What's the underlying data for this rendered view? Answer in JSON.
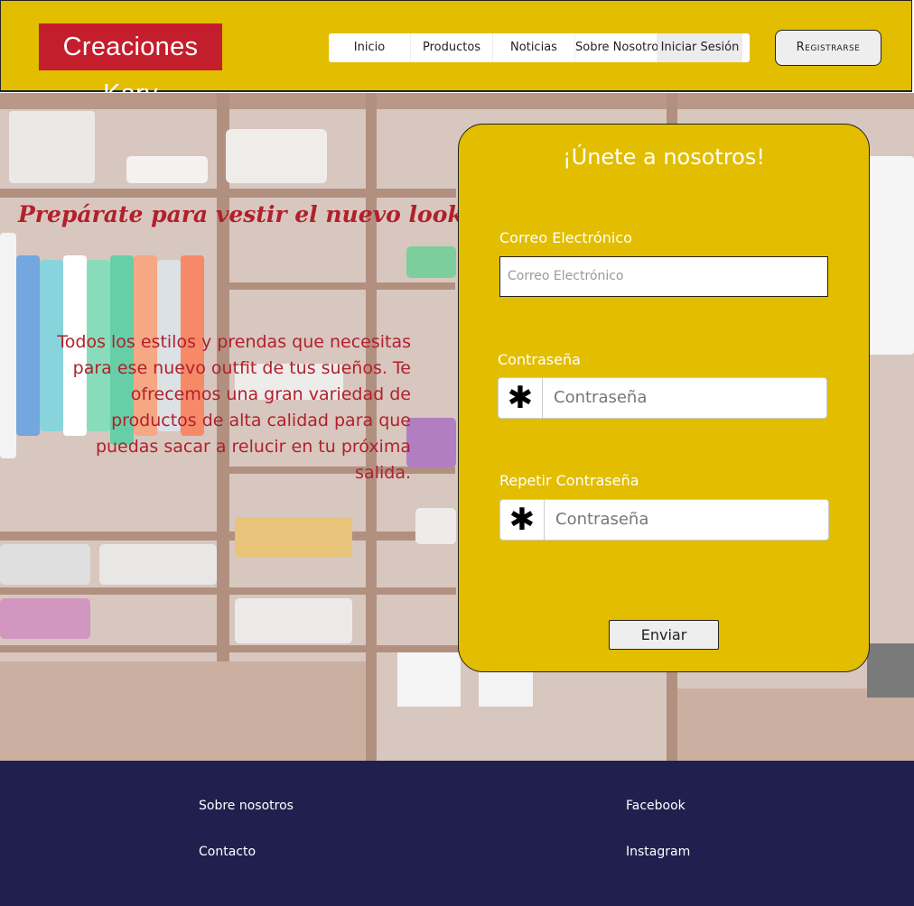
{
  "header": {
    "logo": "Creaciones Kary",
    "nav": [
      "Inicio",
      "Productos",
      "Noticias",
      "Sobre Nosotros",
      "Iniciar Sesión"
    ],
    "register": "Registrarse"
  },
  "hero": {
    "tagline": "Prepárate para vestir el nuevo look up",
    "description": "Todos los estilos y prendas que necesitas para ese nuevo outfit de tus sueños. Te ofrecemos una gran variedad de productos de alta calidad para que puedas sacar a relucir en tu próxima salida."
  },
  "form": {
    "title": "¡Únete a nosotros!",
    "email_label": "Correo Electrónico",
    "email_placeholder": "Correo Electrónico",
    "password_label": "Contraseña",
    "password_placeholder": "Contraseña",
    "repeat_label": "Repetir Contraseña",
    "repeat_placeholder": "Contraseña",
    "submit": "Enviar",
    "password_icon": "asterisk-icon"
  },
  "footer": {
    "about": "Sobre nosotros",
    "contact": "Contacto",
    "facebook": "Facebook",
    "instagram": "Instagram"
  },
  "colors": {
    "primary_yellow": "#e2bd00",
    "brand_red": "#c41e2c",
    "footer_navy": "#20204f"
  }
}
